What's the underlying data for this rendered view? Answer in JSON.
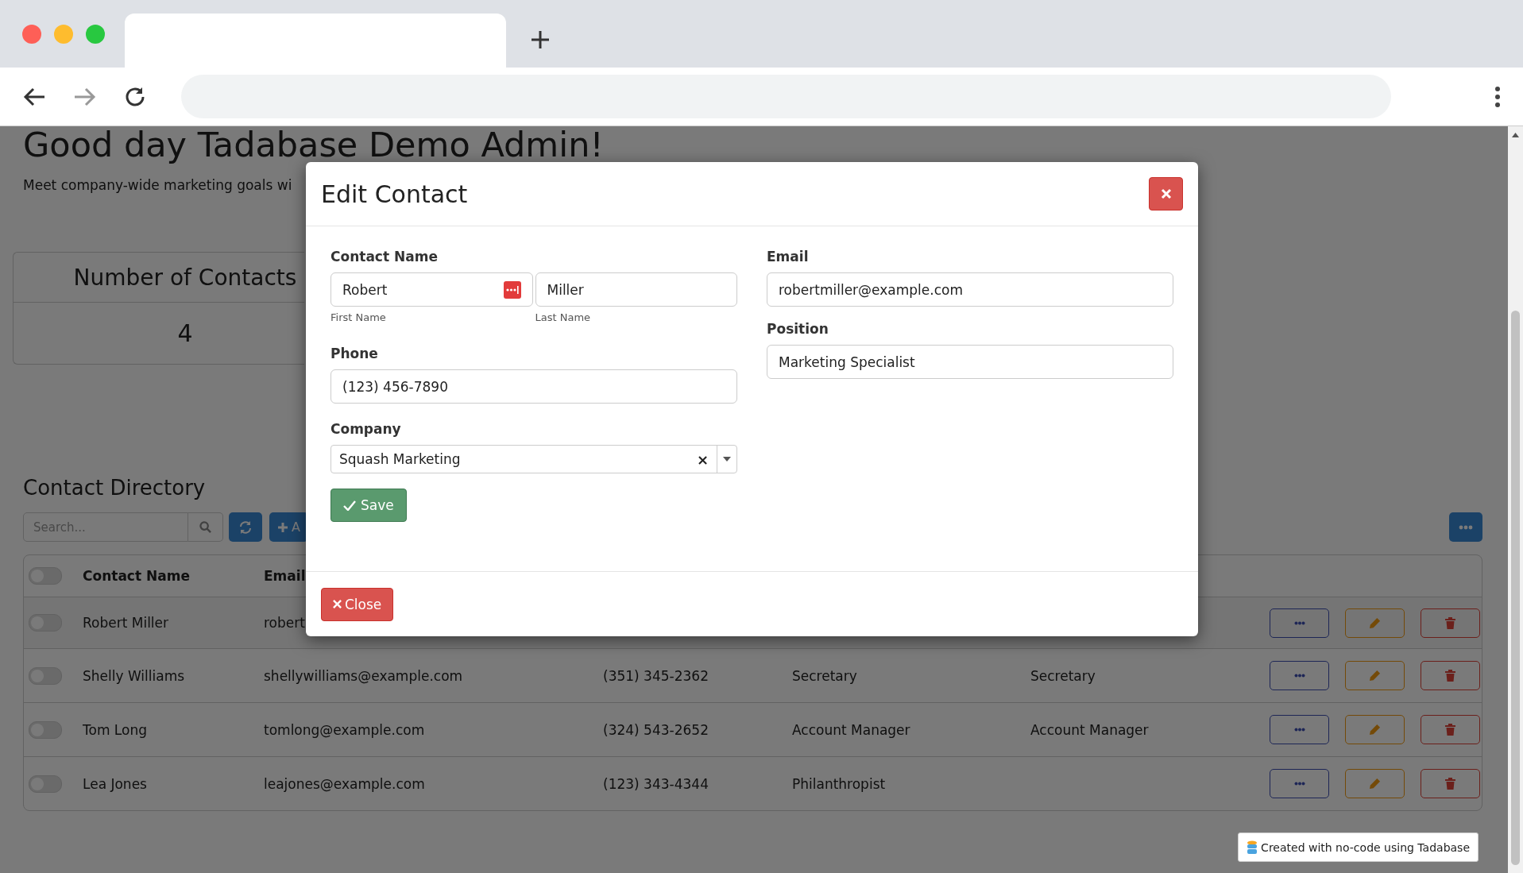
{
  "page": {
    "greeting": "Good day Tadabase Demo Admin!",
    "subtitle": "Meet company-wide marketing goals wi"
  },
  "stat_card": {
    "title": "Number of Contacts",
    "value": "4"
  },
  "directory": {
    "title": "Contact Directory",
    "search": {
      "placeholder": "Search..."
    },
    "add_button": "A",
    "header_toggle": {
      "on": false
    },
    "columns": [
      "Contact Name",
      "Email"
    ],
    "rows": [
      {
        "on": false,
        "name": "Robert Miller",
        "email": "robert"
      },
      {
        "on": false,
        "name": "Shelly Williams",
        "email": "shellywilliams@example.com",
        "phone": "(351) 345-2362",
        "position": "Secretary",
        "column_5": "Secretary"
      },
      {
        "on": false,
        "name": "Tom Long",
        "email": "tomlong@example.com",
        "phone": "(324) 543-2652",
        "position": "Account Manager",
        "column_5": "Account Manager"
      },
      {
        "on": false,
        "name": "Lea Jones",
        "email": "leajones@example.com",
        "phone": "(123) 343-4344",
        "position": "Philanthropist"
      }
    ]
  },
  "modal": {
    "title": "Edit Contact",
    "contact_name": {
      "label": "Contact Name",
      "first": {
        "value": "Robert",
        "hint": "First Name"
      },
      "last": {
        "value": "Miller",
        "hint": "Last Name"
      }
    },
    "phone": {
      "label": "Phone",
      "value": "(123) 456-7890"
    },
    "company": {
      "label": "Company",
      "value": "Squash Marketing",
      "clear": "×"
    },
    "email": {
      "label": "Email",
      "value": "robertmiller@example.com"
    },
    "position": {
      "label": "Position",
      "value": "Marketing Specialist"
    },
    "save_button": "Save",
    "close_button": "Close"
  },
  "badge": "Created with no-code using Tadabase"
}
